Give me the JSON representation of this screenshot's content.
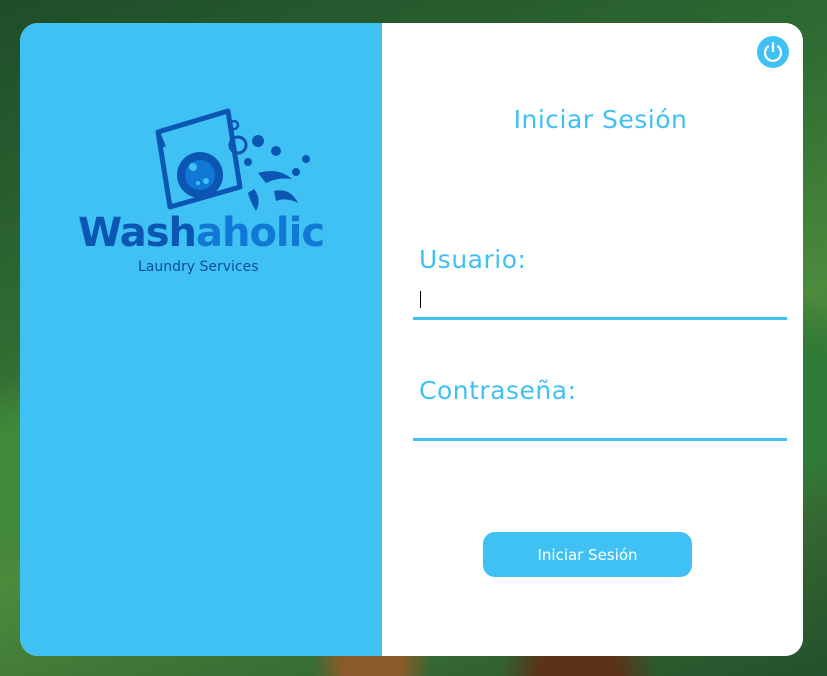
{
  "brand": {
    "name_part1": "Wash",
    "name_part2": "aholic",
    "tagline": "Laundry Services"
  },
  "login": {
    "title": "Iniciar Sesión",
    "username_label": "Usuario:",
    "username_value": "",
    "password_label": "Contraseña:",
    "password_value": "",
    "submit_label": "Iniciar Sesión"
  },
  "icons": {
    "power": "power-icon",
    "logo": "washing-machine-logo-icon"
  },
  "colors": {
    "accent": "#3fc1f3",
    "brand_dark": "#0b55b3",
    "brand_light": "#1178d6",
    "panel_bg": "#ffffff"
  }
}
